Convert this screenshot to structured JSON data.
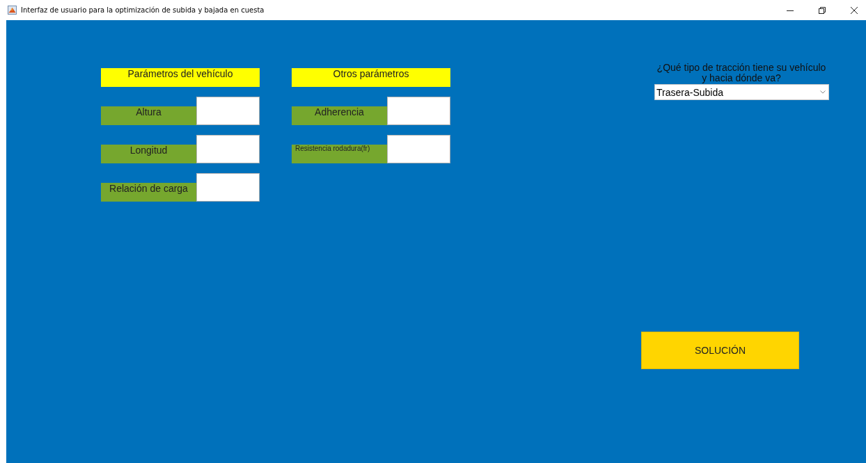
{
  "window": {
    "title": "Interfaz de usuario para la optimización de subida y bajada en cuesta"
  },
  "panels": [
    {
      "heading": "Parámetros del vehículo",
      "fields": [
        {
          "label": "Altura",
          "kind": "standard"
        },
        {
          "label": "Longitud",
          "kind": "standard"
        },
        {
          "label": "Relación de carga",
          "kind": "standard"
        }
      ]
    },
    {
      "heading": "Otros parámetros",
      "fields": [
        {
          "label": "Adherencia",
          "kind": "standard"
        },
        {
          "label": "Resistencia rodadura(fr)",
          "kind": "compact"
        }
      ]
    }
  ],
  "traction": {
    "question": "¿Qué tipo de tracción tiene su vehículo\ny hacia dónde va?",
    "value": "Trasera-Subida"
  },
  "solve_button": {
    "label": "SOLUCIÓN"
  }
}
